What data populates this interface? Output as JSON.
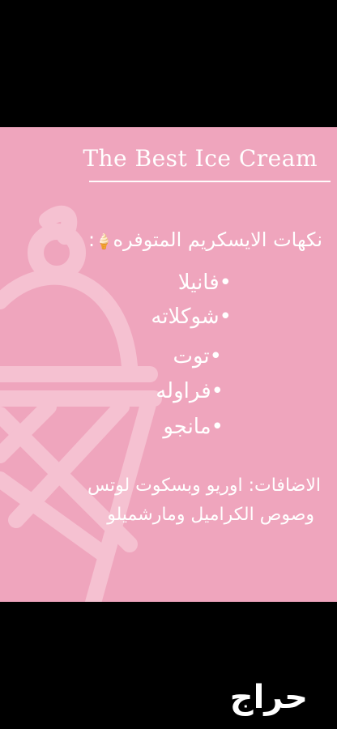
{
  "card": {
    "title": "The Best Ice Cream",
    "heading": "نكهات الايسكريم المتوفره",
    "heading_suffix": ":",
    "flavors": [
      "•فانيلا",
      "•شوكلاته",
      "•توت",
      "•فراوله",
      "•مانجو"
    ],
    "extras_line1": "الاضافات: اوريو وبسكوت لوتس",
    "extras_line2": "وصوص الكراميل ومارشميلو",
    "ice_cream_icon": "ice-cream-cone-icon"
  },
  "watermark": {
    "text": "حراج"
  },
  "colors": {
    "background": "#000000",
    "card": "#efa5bd",
    "text": "#ffffff"
  }
}
